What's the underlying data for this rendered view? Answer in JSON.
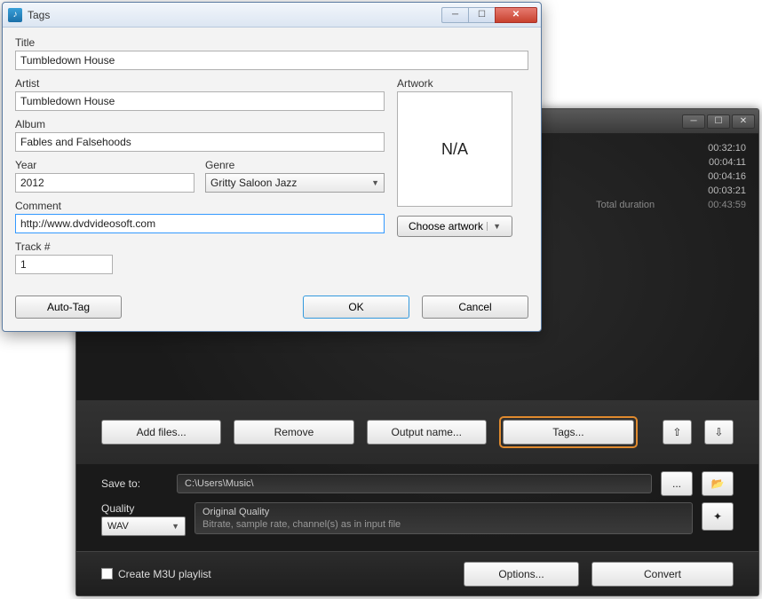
{
  "main": {
    "durations": [
      "00:32:10",
      "00:04:11",
      "00:04:16",
      "00:03:21"
    ],
    "total_label": "Total duration",
    "total_value": "00:43:59",
    "toolbar": {
      "add_files": "Add files...",
      "remove": "Remove",
      "output_name": "Output name...",
      "tags": "Tags...",
      "move_up": "⇧",
      "move_down": "⇩"
    },
    "save_to_label": "Save to:",
    "save_to_value": "C:\\Users\\Music\\",
    "browse": "...",
    "open_folder_icon": "📂",
    "quality_label": "Quality",
    "quality_format": "WAV",
    "quality_title": "Original Quality",
    "quality_desc": "Bitrate, sample rate, channel(s) as in input file",
    "wand_icon": "✦",
    "create_playlist": "Create M3U playlist",
    "options": "Options...",
    "convert": "Convert"
  },
  "dialog": {
    "window_title": "Tags",
    "labels": {
      "title": "Title",
      "artist": "Artist",
      "album": "Album",
      "year": "Year",
      "genre": "Genre",
      "comment": "Comment",
      "track": "Track #",
      "artwork": "Artwork"
    },
    "values": {
      "title": "Tumbledown House",
      "artist": "Tumbledown House",
      "album": "Fables and Falsehoods",
      "year": "2012",
      "genre": "Gritty Saloon Jazz",
      "comment": "http://www.dvdvideosoft.com",
      "track": "1",
      "artwork_na": "N/A"
    },
    "buttons": {
      "choose_artwork": "Choose artwork",
      "auto_tag": "Auto-Tag",
      "ok": "OK",
      "cancel": "Cancel"
    }
  }
}
